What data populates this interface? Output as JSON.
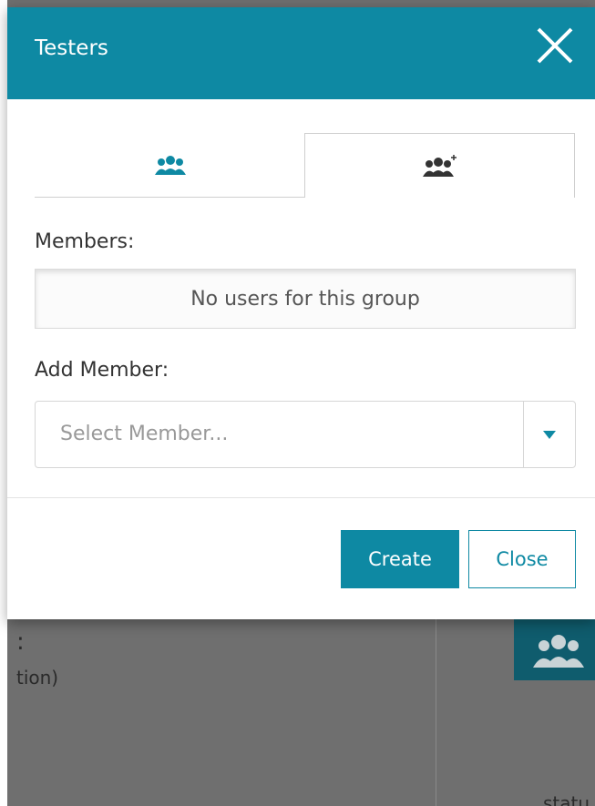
{
  "modal": {
    "title": "Testers",
    "close_icon": "close-icon"
  },
  "tabs": [
    {
      "name": "members",
      "icon": "users-group-icon",
      "active": false
    },
    {
      "name": "add-member",
      "icon": "add-user-group-icon",
      "active": true
    }
  ],
  "members": {
    "label": "Members:",
    "empty_text": "No users for this group"
  },
  "add_member": {
    "label": "Add Member:",
    "placeholder": "Select Member..."
  },
  "buttons": {
    "create_label": "Create",
    "close_label": "Close"
  },
  "background": {
    "text_1": ":",
    "text_2": "tion)",
    "text_3": "statu"
  },
  "colors": {
    "accent": "#0e89a3",
    "header_text": "#ffffff",
    "dim_backdrop": "#6f6f6f"
  }
}
